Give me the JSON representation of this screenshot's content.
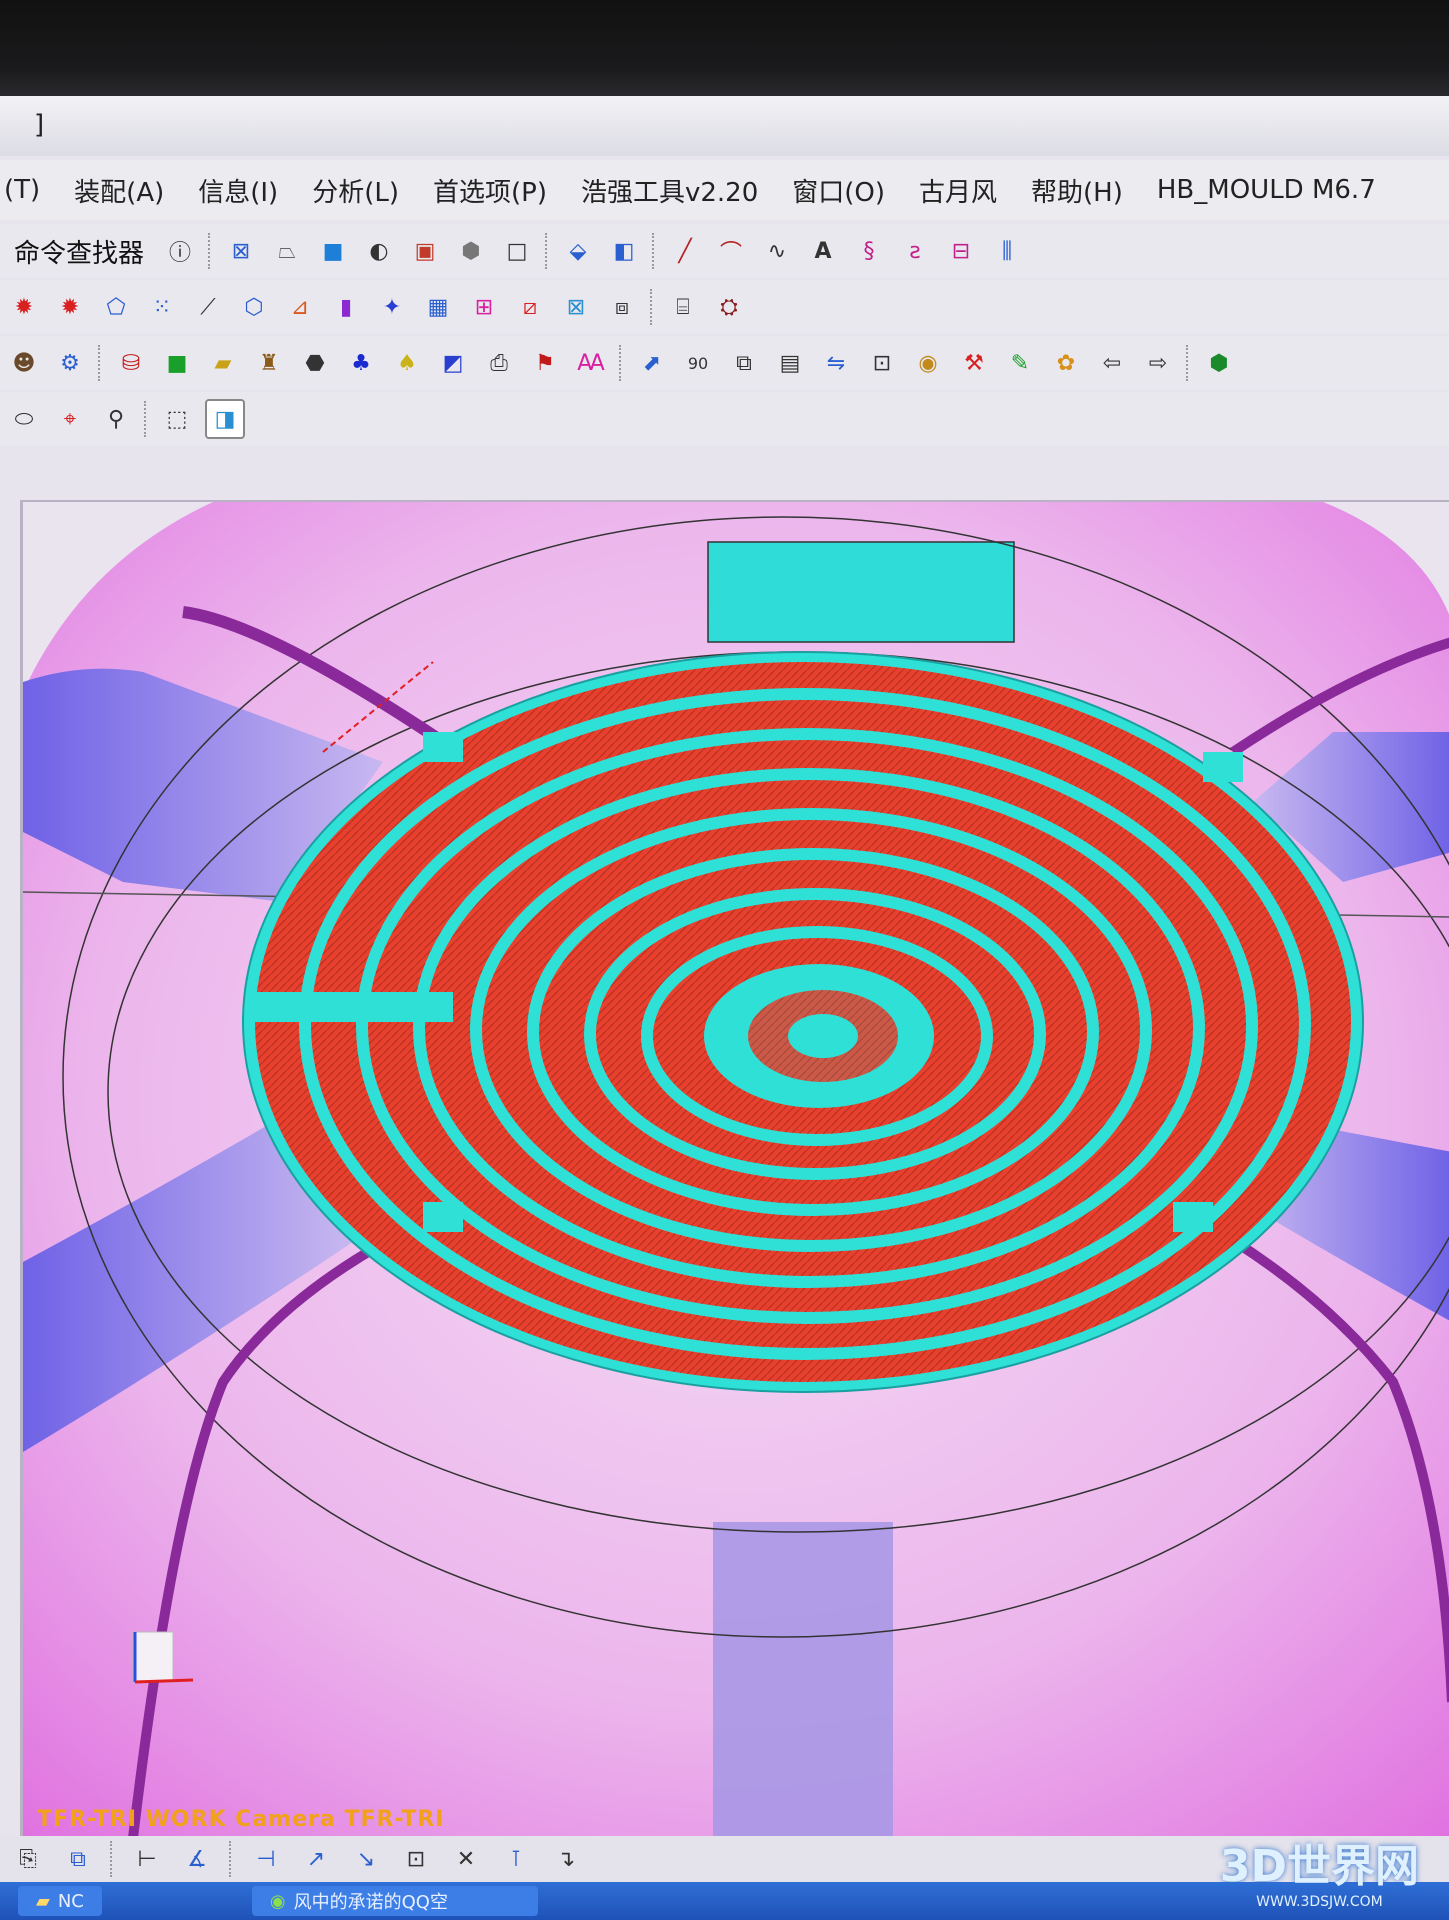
{
  "window": {
    "title_fragment": "]"
  },
  "menu": [
    {
      "label": "(T)"
    },
    {
      "label": "装配(A)"
    },
    {
      "label": "信息(I)"
    },
    {
      "label": "分析(L)"
    },
    {
      "label": "首选项(P)"
    },
    {
      "label": "浩强工具v2.20"
    },
    {
      "label": "窗口(O)"
    },
    {
      "label": "古月风"
    },
    {
      "label": "帮助(H)"
    },
    {
      "label": "HB_MOULD M6.7"
    }
  ],
  "toolbar": {
    "command_finder_label": "命令查找器"
  },
  "viewport": {
    "camera_label": "TFR-TRI WORK Camera TFR-TRI",
    "colors": {
      "background": "#e9c6ea",
      "toolpath_red": "#e8402e",
      "toolpath_cyan": "#2fe0d6",
      "region_purple": "#9a86e0",
      "region_cyan": "#30dcd8",
      "runner_purple": "#8a2a9a"
    }
  },
  "taskbar": {
    "items": [
      {
        "label": "NC",
        "icon": "folder-icon"
      },
      {
        "label": "风中的承诺的QQ空",
        "icon": "browser-icon"
      }
    ]
  },
  "watermark": {
    "text": "3D世界网",
    "url": "WWW.3DSJW.COM"
  }
}
